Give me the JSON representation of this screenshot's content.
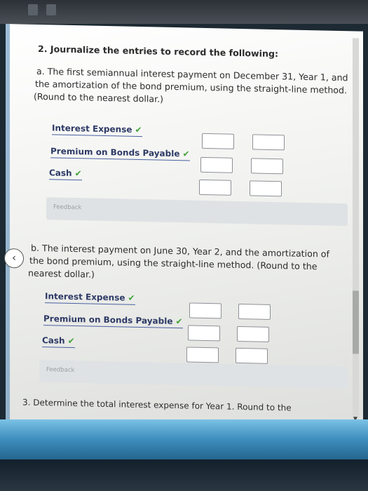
{
  "question2": {
    "heading": "2. Journalize the entries to record the following:",
    "part_a": {
      "line1": "a.  The first semiannual interest payment on December 31, Year 1, and",
      "line2": "the amortization of the bond premium, using the straight-line method.",
      "line3": "(Round to the nearest dollar.)",
      "accounts": [
        {
          "label": "Interest Expense",
          "check": "✔"
        },
        {
          "label": "Premium on Bonds Payable",
          "check": "✔"
        },
        {
          "label": "Cash",
          "check": "✔"
        }
      ],
      "feedback": "Feedback"
    },
    "part_b": {
      "line1": "b.  The interest payment on June 30, Year 2, and the amortization of",
      "line2": "the bond premium, using the straight-line method. (Round to the",
      "line3": "nearest dollar.)",
      "accounts": [
        {
          "label": "Interest Expense",
          "check": "✔"
        },
        {
          "label": "Premium on Bonds Payable",
          "check": "✔"
        },
        {
          "label": "Cash",
          "check": "✔"
        }
      ],
      "feedback": "Feedback"
    }
  },
  "question3": {
    "text": "3.  Determine the total interest expense for Year 1. Round to the"
  },
  "nav": {
    "back": "‹"
  },
  "colors": {
    "accent": "#2d3a66",
    "check": "#46a33d",
    "screen_bar": "#3f8fbf"
  }
}
